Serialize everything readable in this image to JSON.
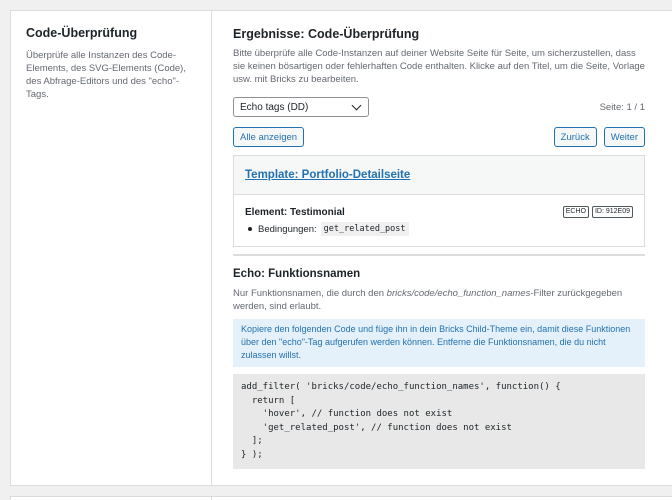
{
  "left": {
    "title": "Code-Überprüfung",
    "description": "Überprüfe alle Instanzen des Code-Elements, des SVG-Elements (Code), des Abfrage-Editors und des \"echo\"-Tags."
  },
  "results": {
    "title": "Ergebnisse: Code-Überprüfung",
    "description": "Bitte überprüfe alle Code-Instanzen auf deiner Website Seite für Seite, um sicherzustellen, dass sie keinen bösartigen oder fehlerhaften Code enthalten. Klicke auf den Titel, um die Seite, Vorlage usw. mit Bricks zu bearbeiten.",
    "filter_select": {
      "value": "Echo tags (DD)"
    },
    "pager": "Seite: 1 / 1",
    "buttons": {
      "show_all": "Alle anzeigen",
      "back": "Zurück",
      "next": "Weiter"
    },
    "card": {
      "link": "Template: Portfolio-Detailseite",
      "element_title": "Element: Testimonial",
      "badges": [
        "ECHO",
        "ID: 912E09"
      ],
      "condition_label": "Bedingungen:",
      "condition_code": "get_related_post"
    }
  },
  "echo_section": {
    "title": "Echo: Funktionsnamen",
    "desc_prefix": "Nur Funktionsnamen, die durch den ",
    "desc_italic": "bricks/code/echo_function_names",
    "desc_suffix": "-Filter zurückgegeben werden, sind erlaubt.",
    "notice": "Kopiere den folgenden Code und füge ihn in dein Bricks Child-Theme ein, damit diese Funktionen über den \"echo\"-Tag aufgerufen werden können. Entferne die Funktionsnamen, die du nicht zulassen willst.",
    "code_lines": [
      "add_filter( 'bricks/code/echo_function_names', function() {",
      "  return [",
      "    'hover', // function does not exist",
      "    'get_related_post', // function does not exist",
      "  ];",
      "} );"
    ]
  }
}
